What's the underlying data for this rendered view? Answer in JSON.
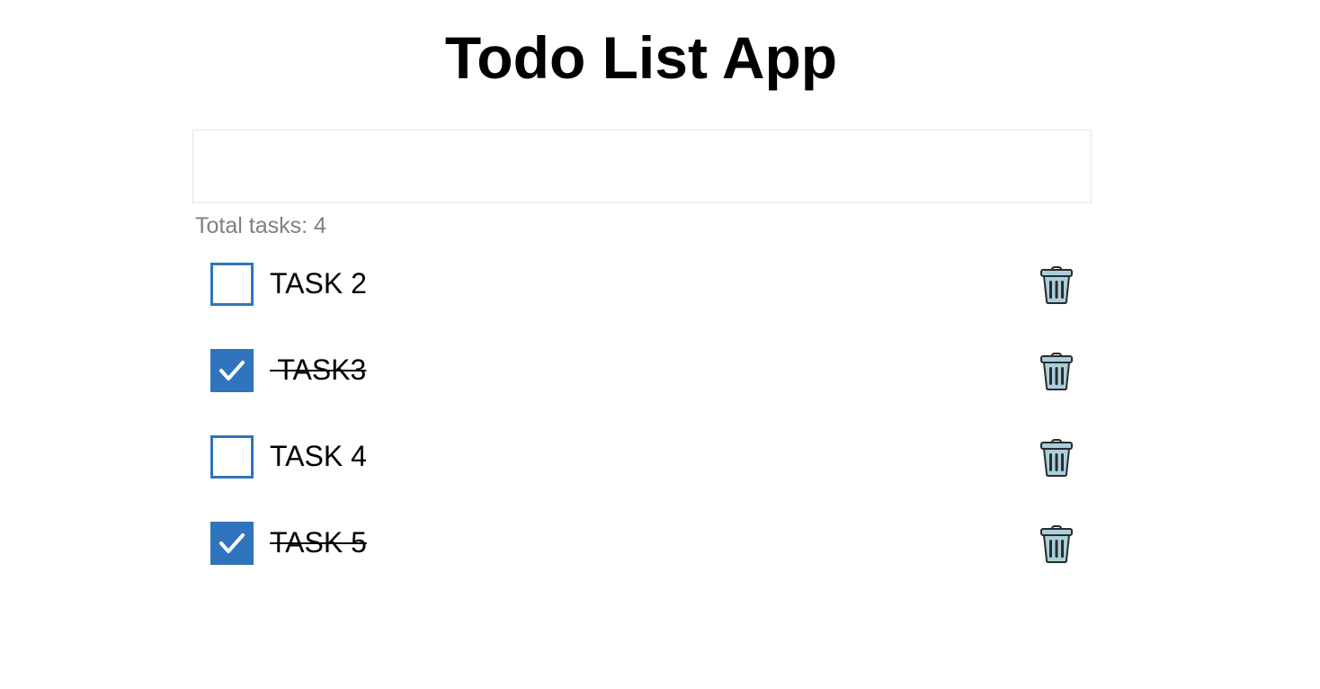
{
  "app": {
    "title": "Todo List App"
  },
  "input": {
    "value": "",
    "placeholder": ""
  },
  "summary": {
    "total_label": "Total tasks: 4"
  },
  "tasks": [
    {
      "label": "TASK 2",
      "completed": false
    },
    {
      "label": " TASK3",
      "completed": true
    },
    {
      "label": "TASK 4",
      "completed": false
    },
    {
      "label": "TASK 5",
      "completed": true
    }
  ],
  "icons": {
    "checkmark": "check-icon",
    "delete": "trash-icon"
  },
  "colors": {
    "accent": "#2f74bd",
    "muted_text": "#808080",
    "trash_fill": "#a9cfdc"
  }
}
